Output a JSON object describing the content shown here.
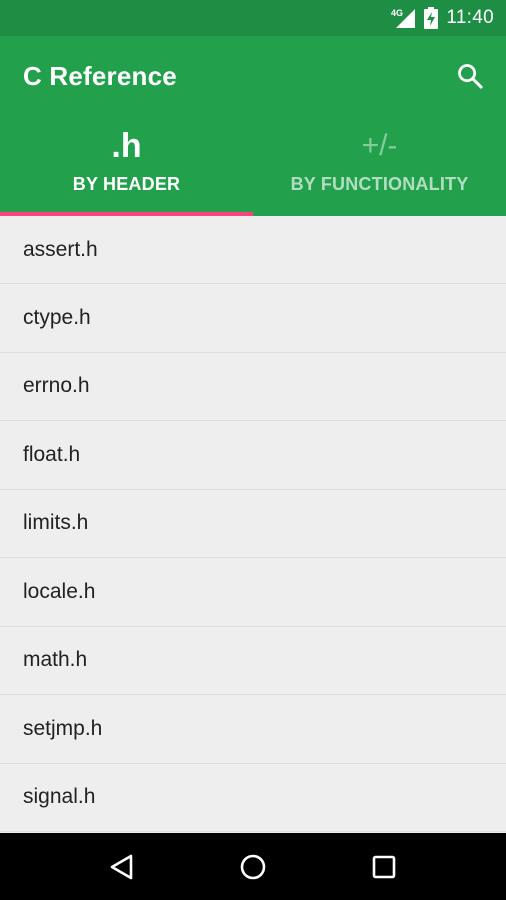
{
  "status_bar": {
    "network": "4G",
    "time": "11:40"
  },
  "toolbar": {
    "title": "C Reference",
    "search_icon": "search-icon"
  },
  "tabs": [
    {
      "symbol": ".h",
      "label": "BY HEADER",
      "active": true
    },
    {
      "symbol": "+/-",
      "label": "BY FUNCTIONALITY",
      "active": false
    }
  ],
  "headers": [
    "assert.h",
    "ctype.h",
    "errno.h",
    "float.h",
    "limits.h",
    "locale.h",
    "math.h",
    "setjmp.h",
    "signal.h"
  ],
  "navigation": {
    "back_icon": "back-icon",
    "home_icon": "home-icon",
    "recents_icon": "recents-icon"
  },
  "colors": {
    "status_bar": "#1e8e45",
    "app_bar": "#22a04c",
    "tab_indicator": "#ff4081",
    "list_background": "#eeeeee"
  }
}
